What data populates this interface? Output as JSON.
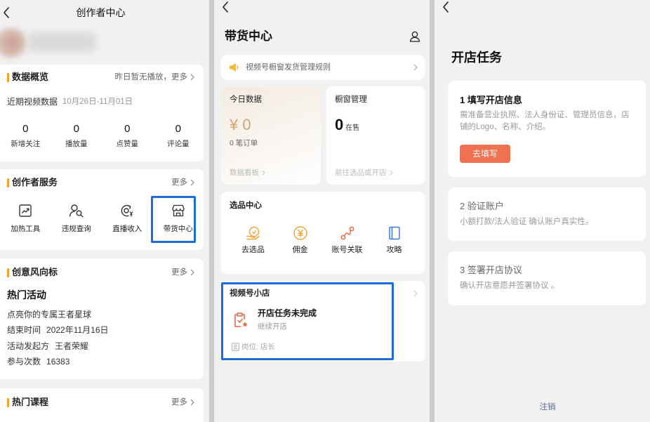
{
  "colors": {
    "accent_bar": "#f5a12c",
    "highlight": "#1d6bd8",
    "amount": "#d6a56d",
    "selection_icon": "#f2a43a",
    "link_icon": "#ec6a3f",
    "guide_icon": "#3b7be4",
    "task_button": "#ef7152",
    "shop_icon": "#e9623d",
    "link_blue": "#576b95"
  },
  "creator_center": {
    "title": "创作者中心",
    "back_icon": "back-chevron-icon",
    "data_overview": {
      "title": "数据概览",
      "more": "昨日暂无播放，更多",
      "period_label": "近期视频数据",
      "period_range": "10月26日-11月01日",
      "stats": [
        {
          "value": "0",
          "label": "新增关注"
        },
        {
          "value": "0",
          "label": "播放量"
        },
        {
          "value": "0",
          "label": "点赞量"
        },
        {
          "value": "0",
          "label": "评论量"
        }
      ]
    },
    "services": {
      "title": "创作者服务",
      "more": "更多",
      "items": [
        {
          "label": "加热工具",
          "icon": "trend-chart-icon"
        },
        {
          "label": "违规查询",
          "icon": "user-search-icon"
        },
        {
          "label": "直播收入",
          "icon": "live-income-icon"
        },
        {
          "label": "带货中心",
          "icon": "storefront-icon",
          "highlighted": true
        }
      ]
    },
    "trends": {
      "title": "创意风向标",
      "more": "更多",
      "heading": "热门活动",
      "activity": "点亮你的专属王者星球",
      "details": [
        {
          "label": "结束时间",
          "value": "2022年11月16日"
        },
        {
          "label": "活动发起方",
          "value": "王者荣耀"
        },
        {
          "label": "参与次数",
          "value": "16383"
        }
      ]
    },
    "courses": {
      "title": "热门课程",
      "more": "更多"
    }
  },
  "sales_center": {
    "title": "带货中心",
    "notice": "视频号橱窗发货管理规则",
    "today": {
      "title": "今日数据",
      "amount": "¥ 0",
      "orders": "0 笔订单",
      "link": "数据看板"
    },
    "showcase": {
      "title": "橱窗管理",
      "count": "0",
      "count_label": "在售",
      "link": "前往选品或开店"
    },
    "selection": {
      "title": "选品中心",
      "items": [
        {
          "label": "去选品",
          "icon": "pick-products-icon"
        },
        {
          "label": "佣金",
          "icon": "commission-icon"
        },
        {
          "label": "账号关联",
          "icon": "account-link-icon"
        },
        {
          "label": "攻略",
          "icon": "guide-book-icon"
        }
      ]
    },
    "shop": {
      "title": "视频号小店",
      "task_title": "开店任务未完成",
      "task_subtitle": "继续开店",
      "role": "岗位: 店长",
      "highlighted": true
    }
  },
  "shop_tasks": {
    "title": "开店任务",
    "steps": [
      {
        "title": "1 填写开店信息",
        "description": "需准备营业执照、法人身份证、管理员信息，店铺的Logo、名称、介绍。",
        "button": "去填写",
        "active": true
      },
      {
        "title": "2 验证账户",
        "description": "小额打款/法人验证 确认账户真实性。",
        "active": false
      },
      {
        "title": "3 签署开店协议",
        "description": "确认开店意愿并签署协议 。",
        "active": false
      }
    ],
    "cancel": "注销"
  }
}
